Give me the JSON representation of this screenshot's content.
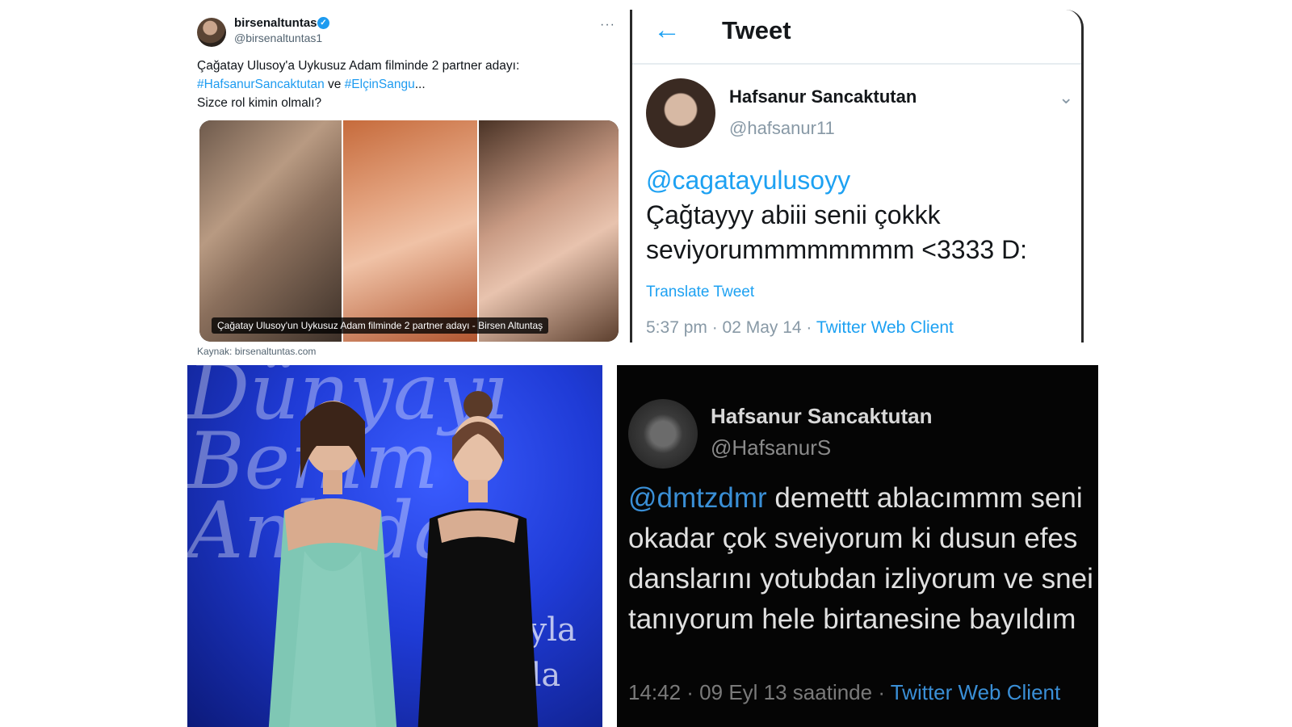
{
  "panel1": {
    "user_name": "birsenaltuntas",
    "handle": "@birsenaltuntas1",
    "verified_icon": "verified-badge-icon",
    "more_icon": "more-icon",
    "more_glyph": "···",
    "line1": "Çağatay Ulusoy'a Uykusuz Adam filminde 2 partner adayı:",
    "hashtag1": "#HafsanurSancaktutan",
    "conj": " ve ",
    "hashtag2": "#ElçinSangu",
    "ellipsis": "...",
    "line3": "Sizce rol kimin olmalı?",
    "media_caption": "Çağatay Ulusoy'un Uykusuz Adam filminde 2 partner adayı - Birsen Altuntaş",
    "source": "Kaynak: birsenaltuntas.com",
    "accent": "#1d9bf0"
  },
  "panel2": {
    "header_title": "Tweet",
    "back_icon": "back-arrow-icon",
    "back_glyph": "←",
    "user_name": "Hafsanur Sancaktutan",
    "handle": "@hafsanur11",
    "chevron_glyph": "⌄",
    "mention": "@cagatayulusoyy",
    "body": "Çağtayyy abiii senii çokkk seviyorummmmmmmm <3333 D:",
    "translate": "Translate Tweet",
    "meta": "5:37 pm · 02 May 14 · ",
    "client": "Twitter Web Client",
    "accent": "#1da1f2"
  },
  "panel4": {
    "user_name": "Hafsanur Sancaktutan",
    "handle": "@HafsanurS",
    "mention": "@dmtzdmr",
    "body": " demettt ablacımmm seni okadar çok sveiyorum ki dusun efes danslarını yotubdan izliyorum ve snei tanıyorum hele birtanesine bayıldım",
    "meta": "14:42 · 09 Eyl 13 saatinde · ",
    "client": "Twitter Web Client"
  }
}
